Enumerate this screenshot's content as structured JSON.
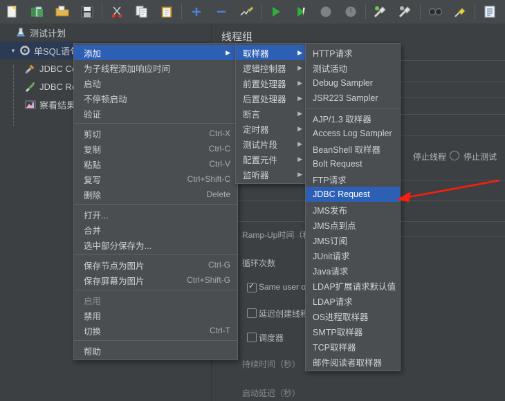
{
  "app": {
    "title": "JMeter 测试计划编辑器"
  },
  "toolbar": {
    "buttons": [
      {
        "name": "new-icon",
        "glyph": "🗒",
        "label": "新建"
      },
      {
        "name": "templates-icon",
        "glyph": "📚",
        "label": "模板"
      },
      {
        "name": "open-icon",
        "glyph": "📂",
        "label": "打开"
      },
      {
        "name": "save-icon",
        "glyph": "💾",
        "label": "保存"
      },
      {
        "name": "cut-icon",
        "glyph": "✂",
        "label": "剪切"
      },
      {
        "name": "copy-icon",
        "glyph": "📄",
        "label": "复制"
      },
      {
        "name": "paste-icon",
        "glyph": "📋",
        "label": "粘贴"
      },
      {
        "name": "expand-all-icon",
        "glyph": "✚",
        "label": "展开全部"
      },
      {
        "name": "collapse-all-icon",
        "glyph": "━",
        "label": "折叠全部"
      },
      {
        "name": "toggle-icon",
        "glyph": "🖊",
        "label": "切换"
      },
      {
        "name": "start-icon",
        "glyph": "▶",
        "label": "启动"
      },
      {
        "name": "start-no-pause-icon",
        "glyph": "▶",
        "label": "不停顿启动"
      },
      {
        "name": "stop-icon",
        "glyph": "⬤",
        "label": "停止"
      },
      {
        "name": "shutdown-icon",
        "glyph": "⬤",
        "label": "关闭"
      },
      {
        "name": "clear-icon",
        "glyph": "🧹",
        "label": "清除"
      },
      {
        "name": "clear-all-icon",
        "glyph": "🧹",
        "label": "清除全部"
      },
      {
        "name": "search-icon",
        "glyph": "🔍",
        "label": "搜索"
      },
      {
        "name": "reset-search-icon",
        "glyph": "🖌",
        "label": "重置搜索"
      },
      {
        "name": "function-helper-icon",
        "glyph": "📋",
        "label": "函数助手"
      }
    ]
  },
  "tree": {
    "nodes": [
      {
        "label": "测试计划",
        "icon": "test-plan-icon",
        "level": 0,
        "twisty": "",
        "selected": false
      },
      {
        "label": "单SQL语句压测",
        "icon": "thread-group-icon",
        "level": 0,
        "twisty": "▼",
        "selected": true
      },
      {
        "label": "JDBC Connection Configuration",
        "icon": "jdbc-config-icon",
        "level": 1,
        "twisty": "",
        "selected": false
      },
      {
        "label": "JDBC Request",
        "icon": "jdbc-request-icon",
        "level": 1,
        "twisty": "",
        "selected": false
      },
      {
        "label": "察看结果树",
        "icon": "view-results-tree-icon",
        "level": 1,
        "twisty": "",
        "selected": false
      }
    ]
  },
  "content": {
    "title": "线程组",
    "labels": {
      "ramp_up": "Ramp-Up时间（秒）",
      "loop_count": "循环次数",
      "same_user": "Same user on each iteration",
      "delay_thread_creation": "延迟创建线程直到需要",
      "scheduler": "调度器",
      "duration": "持续时间（秒）",
      "startup_delay": "启动延迟（秒）",
      "stop_thread": "停止线程",
      "stop_test": "停止测试"
    },
    "checkboxes": {
      "same_user_checked": true,
      "delay_thread_creation_checked": false,
      "scheduler_checked": false
    }
  },
  "menu1": {
    "name": "node-context-menu",
    "items": [
      {
        "label": "添加",
        "accel": "",
        "submenu": true,
        "highlighted": true,
        "disabled": false,
        "separator_after": false
      },
      {
        "label": "为子线程添加响应时间",
        "accel": "",
        "submenu": false,
        "highlighted": false,
        "disabled": false,
        "separator_after": false
      },
      {
        "label": "启动",
        "accel": "",
        "submenu": false,
        "highlighted": false,
        "disabled": false,
        "separator_after": false
      },
      {
        "label": "不停顿启动",
        "accel": "",
        "submenu": false,
        "highlighted": false,
        "disabled": false,
        "separator_after": false
      },
      {
        "label": "验证",
        "accel": "",
        "submenu": false,
        "highlighted": false,
        "disabled": false,
        "separator_after": true
      },
      {
        "label": "剪切",
        "accel": "Ctrl-X",
        "submenu": false,
        "highlighted": false,
        "disabled": false,
        "separator_after": false
      },
      {
        "label": "复制",
        "accel": "Ctrl-C",
        "submenu": false,
        "highlighted": false,
        "disabled": false,
        "separator_after": false
      },
      {
        "label": "粘贴",
        "accel": "Ctrl-V",
        "submenu": false,
        "highlighted": false,
        "disabled": false,
        "separator_after": false
      },
      {
        "label": "复写",
        "accel": "Ctrl+Shift-C",
        "submenu": false,
        "highlighted": false,
        "disabled": false,
        "separator_after": false
      },
      {
        "label": "删除",
        "accel": "Delete",
        "submenu": false,
        "highlighted": false,
        "disabled": false,
        "separator_after": true
      },
      {
        "label": "打开...",
        "accel": "",
        "submenu": false,
        "highlighted": false,
        "disabled": false,
        "separator_after": false
      },
      {
        "label": "合并",
        "accel": "",
        "submenu": false,
        "highlighted": false,
        "disabled": false,
        "separator_after": false
      },
      {
        "label": "选中部分保存为...",
        "accel": "",
        "submenu": false,
        "highlighted": false,
        "disabled": false,
        "separator_after": true
      },
      {
        "label": "保存节点为图片",
        "accel": "Ctrl-G",
        "submenu": false,
        "highlighted": false,
        "disabled": false,
        "separator_after": false
      },
      {
        "label": "保存屏幕为图片",
        "accel": "Ctrl+Shift-G",
        "submenu": false,
        "highlighted": false,
        "disabled": false,
        "separator_after": true
      },
      {
        "label": "启用",
        "accel": "",
        "submenu": false,
        "highlighted": false,
        "disabled": true,
        "separator_after": false
      },
      {
        "label": "禁用",
        "accel": "",
        "submenu": false,
        "highlighted": false,
        "disabled": false,
        "separator_after": false
      },
      {
        "label": "切换",
        "accel": "Ctrl-T",
        "submenu": false,
        "highlighted": false,
        "disabled": false,
        "separator_after": true
      },
      {
        "label": "帮助",
        "accel": "",
        "submenu": false,
        "highlighted": false,
        "disabled": false,
        "separator_after": false
      }
    ]
  },
  "menu2": {
    "name": "add-submenu",
    "items": [
      {
        "label": "取样器",
        "submenu": true,
        "highlighted": true,
        "separator_after": false
      },
      {
        "label": "逻辑控制器",
        "submenu": true,
        "highlighted": false,
        "separator_after": false
      },
      {
        "label": "前置处理器",
        "submenu": true,
        "highlighted": false,
        "separator_after": false
      },
      {
        "label": "后置处理器",
        "submenu": true,
        "highlighted": false,
        "separator_after": false
      },
      {
        "label": "断言",
        "submenu": true,
        "highlighted": false,
        "separator_after": false
      },
      {
        "label": "定时器",
        "submenu": true,
        "highlighted": false,
        "separator_after": false
      },
      {
        "label": "测试片段",
        "submenu": true,
        "highlighted": false,
        "separator_after": false
      },
      {
        "label": "配置元件",
        "submenu": true,
        "highlighted": false,
        "separator_after": false
      },
      {
        "label": "监听器",
        "submenu": true,
        "highlighted": false,
        "separator_after": false
      }
    ]
  },
  "menu3": {
    "name": "sampler-submenu",
    "items": [
      {
        "label": "HTTP请求",
        "highlighted": false,
        "separator_after": false
      },
      {
        "label": "测试活动",
        "highlighted": false,
        "separator_after": false
      },
      {
        "label": "Debug Sampler",
        "highlighted": false,
        "separator_after": false
      },
      {
        "label": "JSR223 Sampler",
        "highlighted": false,
        "separator_after": true
      },
      {
        "label": "AJP/1.3 取样器",
        "highlighted": false,
        "separator_after": false
      },
      {
        "label": "Access Log Sampler",
        "highlighted": false,
        "separator_after": false
      },
      {
        "label": "BeanShell 取样器",
        "highlighted": false,
        "separator_after": false
      },
      {
        "label": "Bolt Request",
        "highlighted": false,
        "separator_after": false
      },
      {
        "label": "FTP请求",
        "highlighted": false,
        "separator_after": false
      },
      {
        "label": "JDBC Request",
        "highlighted": true,
        "separator_after": false
      },
      {
        "label": "JMS发布",
        "highlighted": false,
        "separator_after": false
      },
      {
        "label": "JMS点到点",
        "highlighted": false,
        "separator_after": false
      },
      {
        "label": "JMS订阅",
        "highlighted": false,
        "separator_after": false
      },
      {
        "label": "JUnit请求",
        "highlighted": false,
        "separator_after": false
      },
      {
        "label": "Java请求",
        "highlighted": false,
        "separator_after": false
      },
      {
        "label": "LDAP扩展请求默认值",
        "highlighted": false,
        "separator_after": false
      },
      {
        "label": "LDAP请求",
        "highlighted": false,
        "separator_after": false
      },
      {
        "label": "OS进程取样器",
        "highlighted": false,
        "separator_after": false
      },
      {
        "label": "SMTP取样器",
        "highlighted": false,
        "separator_after": false
      },
      {
        "label": "TCP取样器",
        "highlighted": false,
        "separator_after": false
      },
      {
        "label": "邮件阅读者取样器",
        "highlighted": false,
        "separator_after": false
      }
    ]
  },
  "annotation": {
    "name": "red-arrow-annotation",
    "color": "#fb1d0d",
    "points": "from (722,262) to (575,289)"
  },
  "colors": {
    "window_bg": "#3c4043",
    "toolbar_bg": "#45494c",
    "menu_bg": "#4a4e51",
    "menu_border": "#5e6265",
    "highlight": "#2d5fb5",
    "tree_selection": "#2b3a55",
    "text": "#c8cbcd",
    "disabled_text": "#8a8d8f",
    "accel_text": "#a9acae",
    "annotation_red": "#fb1d0d"
  }
}
